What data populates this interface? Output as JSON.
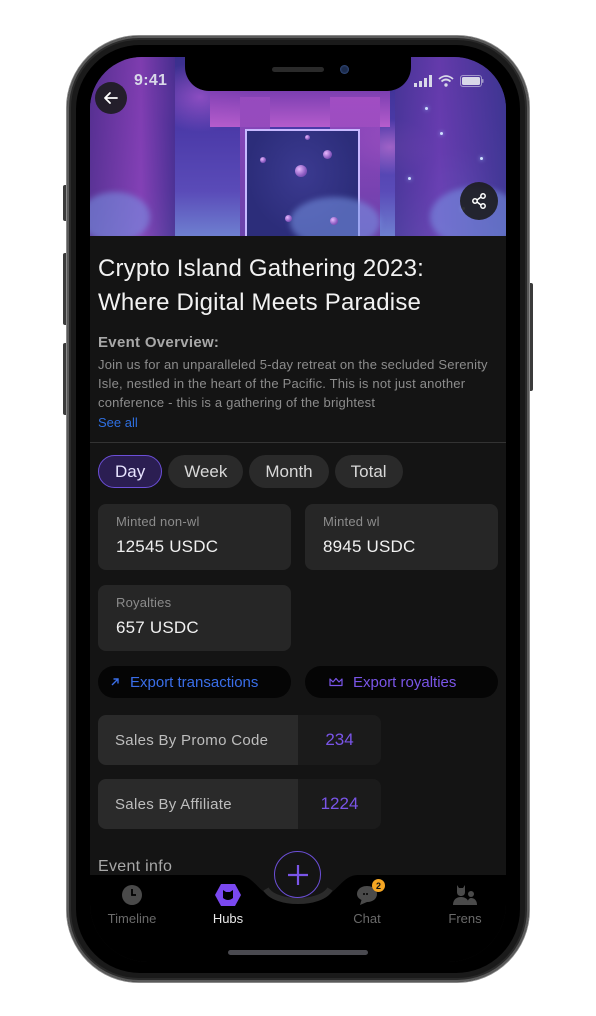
{
  "status_bar": {
    "time": "9:41",
    "icons": [
      "signal-icon",
      "wifi-icon",
      "battery-icon"
    ]
  },
  "header": {
    "back_icon": "arrow-left-icon",
    "share_icon": "share-icon"
  },
  "event": {
    "title": "Crypto Island Gathering 2023: Where Digital Meets Paradise",
    "overview_label": "Event Overview:",
    "overview_text": "Join us for an unparalleled 5-day retreat on the secluded Serenity Isle, nestled in the heart of the Pacific. This is not just another conference - this is a gathering of the brightest",
    "see_all": "See all"
  },
  "period_tabs": {
    "items": [
      {
        "label": "Day",
        "active": true
      },
      {
        "label": "Week",
        "active": false
      },
      {
        "label": "Month",
        "active": false
      },
      {
        "label": "Total",
        "active": false
      }
    ]
  },
  "stats": {
    "minted_non_wl": {
      "label": "Minted non-wl",
      "value": "12545 USDC"
    },
    "minted_wl": {
      "label": "Minted wl",
      "value": "8945 USDC"
    },
    "royalties": {
      "label": "Royalties",
      "value": "657 USDC"
    }
  },
  "actions": {
    "export_transactions": {
      "label": "Export transactions",
      "icon": "arrow-up-right-icon",
      "color": "#3a6ee8"
    },
    "export_royalties": {
      "label": "Export royalties",
      "icon": "crown-icon",
      "color": "#7a55e8"
    }
  },
  "sales": [
    {
      "label": "Sales By Promo Code",
      "value": "234"
    },
    {
      "label": "Sales By Affiliate",
      "value": "1224"
    }
  ],
  "section": {
    "event_info": "Event info"
  },
  "bottom_nav": {
    "items": [
      {
        "label": "Timeline",
        "icon": "clock-icon",
        "active": false
      },
      {
        "label": "Hubs",
        "icon": "hubs-hexagon-icon",
        "active": true
      },
      {
        "label": "Chat",
        "icon": "chat-bubble-icon",
        "active": false,
        "badge": "2"
      },
      {
        "label": "Frens",
        "icon": "friends-icon",
        "active": false
      }
    ],
    "fab_icon": "plus-icon"
  },
  "colors": {
    "accent": "#6c4fd8",
    "link": "#2f6fe0",
    "badge": "#f5a623",
    "background": "#141414"
  }
}
